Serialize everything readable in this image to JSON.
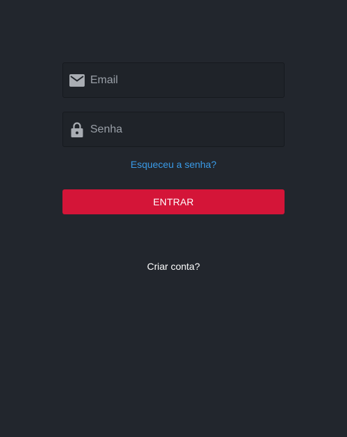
{
  "login_form": {
    "email": {
      "placeholder": "Email",
      "value": "",
      "icon": "mail-icon"
    },
    "password": {
      "placeholder": "Senha",
      "value": "",
      "icon": "lock-icon"
    },
    "forgot_password_link": "Esqueceu a senha?",
    "submit_label": "ENTRAR",
    "create_account_link": "Criar conta?"
  },
  "colors": {
    "background": "#22262d",
    "field_background": "#1f2329",
    "icon": "#a9adb3",
    "link_accent": "#3a9be8",
    "primary_button": "#d41538",
    "text_light": "#ffffff"
  }
}
